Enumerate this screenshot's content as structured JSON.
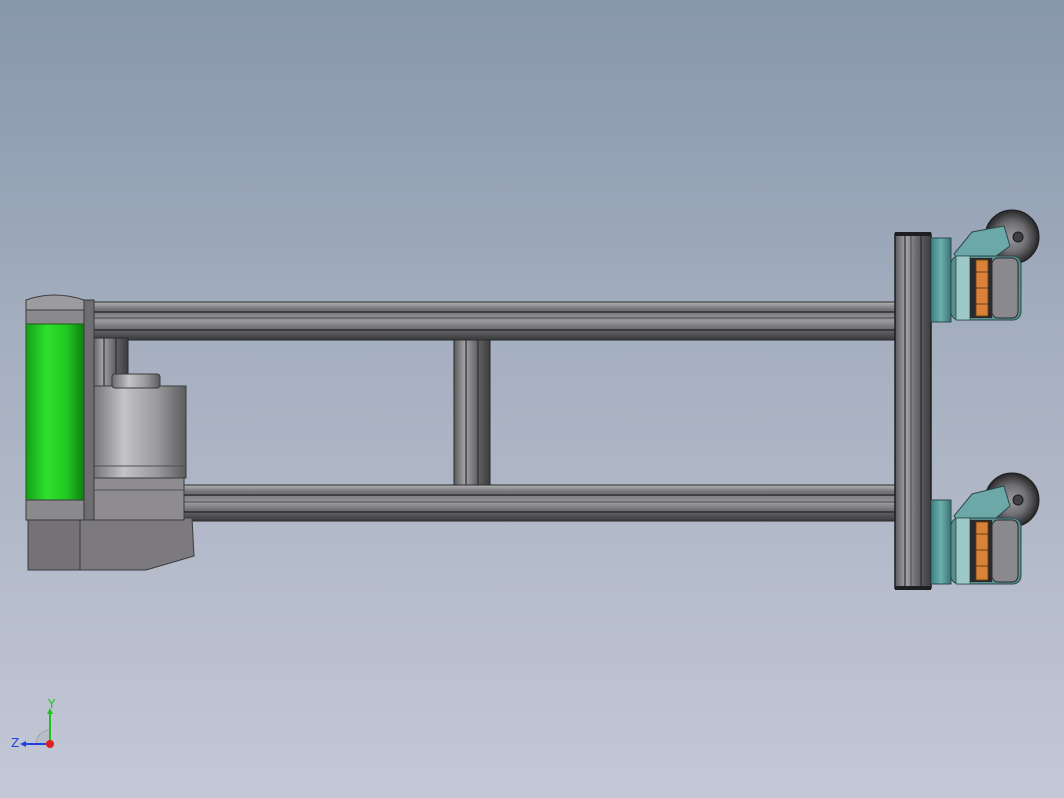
{
  "viewport": {
    "background_top": "#8797ac",
    "background_bottom": "#c4c8d6"
  },
  "model": {
    "colors": {
      "aluminum_profile": "#8a8a8c",
      "profile_dark": "#3a3a3c",
      "roller_green": "#22cc22",
      "motor_gray": "#a8a8aa",
      "gearbox_gray": "#7a787c",
      "caster_teal": "#5fa0a0",
      "bearing_orange": "#d8823a",
      "wheel_dark": "#2e2e32"
    },
    "icons": [
      "green-roller",
      "motor",
      "gearbox",
      "caster-wheel"
    ]
  },
  "triad": {
    "y_label": "Y",
    "z_label": "Z",
    "x_color": "#e02020",
    "y_color": "#20c020",
    "z_color": "#2040e0"
  }
}
